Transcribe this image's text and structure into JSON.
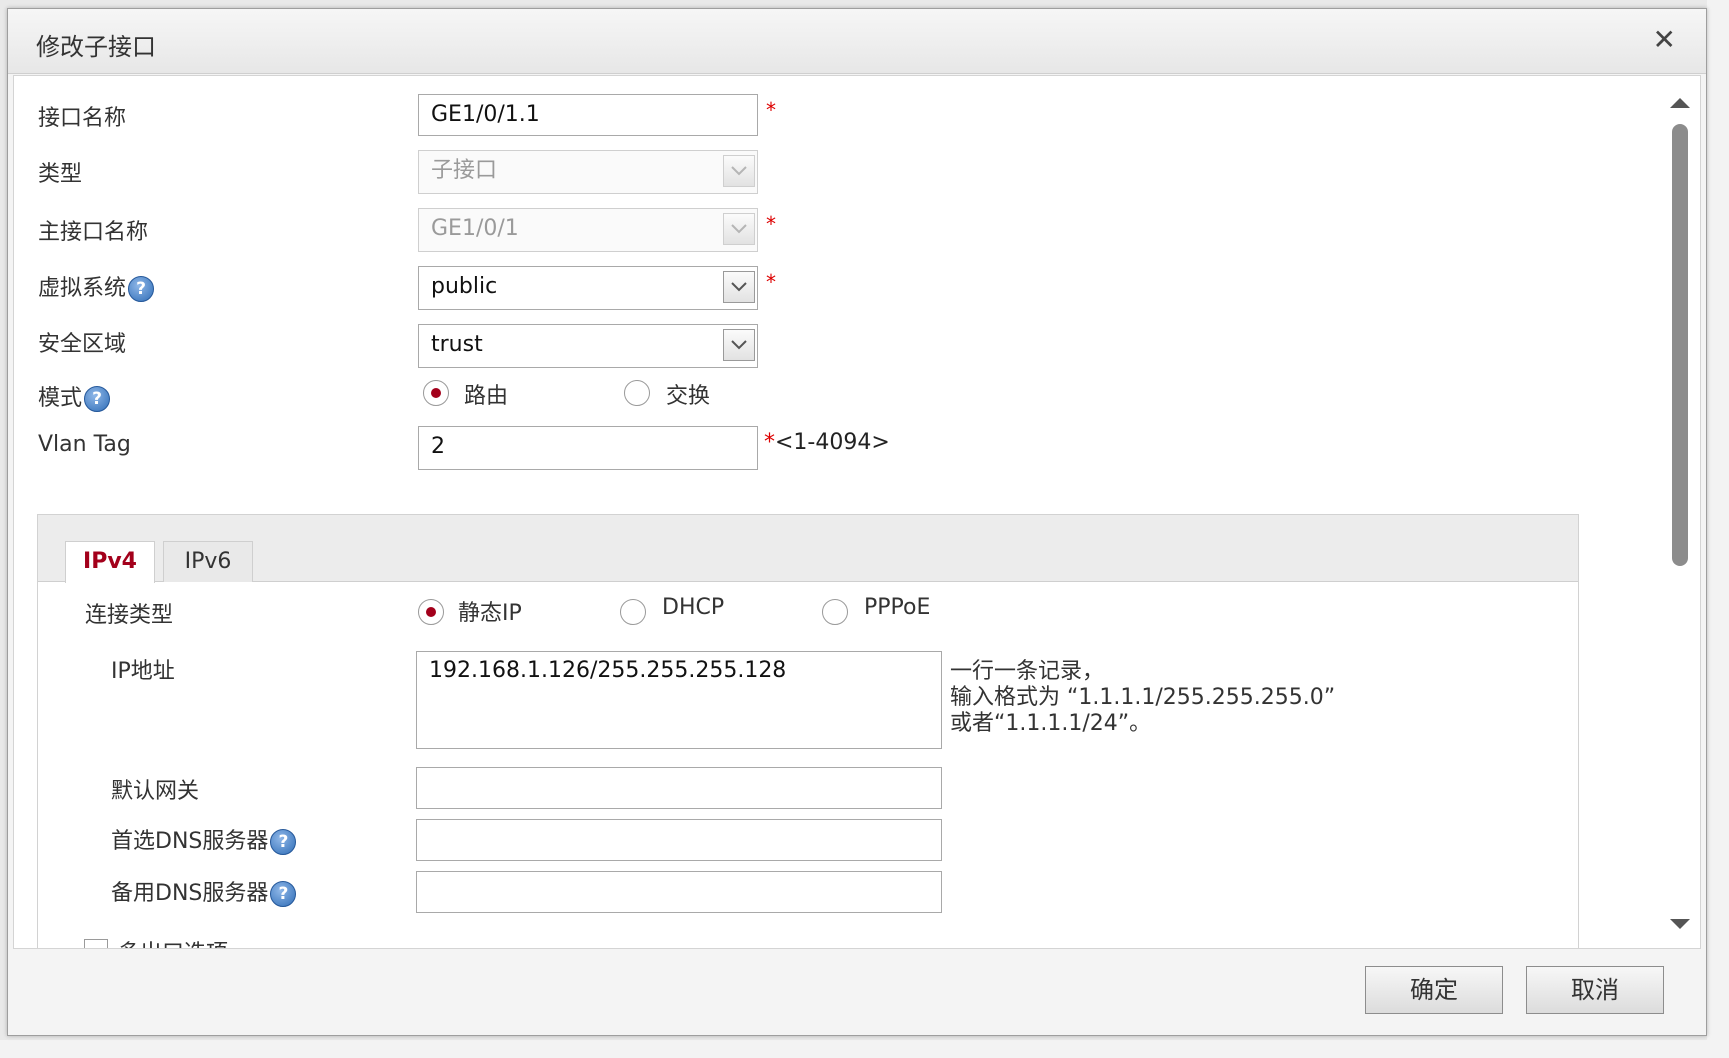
{
  "dialog": {
    "title": "修改子接口",
    "close_label": "✕"
  },
  "form": {
    "interface_name": {
      "label": "接口名称",
      "value": "GE1/0/1.1",
      "required": "*"
    },
    "type": {
      "label": "类型",
      "value": "子接口"
    },
    "parent_interface": {
      "label": "主接口名称",
      "value": "GE1/0/1",
      "required": "*"
    },
    "virtual_system": {
      "label": "虚拟系统",
      "value": "public",
      "required": "*"
    },
    "security_zone": {
      "label": "安全区域",
      "value": "trust"
    },
    "mode": {
      "label": "模式",
      "options": [
        "路由",
        "交换"
      ],
      "selected": "路由"
    },
    "vlan_tag": {
      "label": "Vlan Tag",
      "value": "2",
      "required": "*",
      "range": "<1-4094>"
    },
    "help_glyph": "?"
  },
  "tabs": [
    {
      "label": "IPv4",
      "active": true
    },
    {
      "label": "IPv6",
      "active": false
    }
  ],
  "ipv4": {
    "connection_type": {
      "label": "连接类型",
      "options": [
        "静态IP",
        "DHCP",
        "PPPoE"
      ],
      "selected": "静态IP"
    },
    "ip_address": {
      "label": "IP地址",
      "value": "192.168.1.126/255.255.255.128",
      "hint": [
        "一行一条记录，",
        "输入格式为 “1.1.1.1/255.255.255.0”",
        "或者“1.1.1.1/24”。"
      ]
    },
    "default_gateway": {
      "label": "默认网关",
      "value": ""
    },
    "primary_dns": {
      "label": "首选DNS服务器",
      "value": ""
    },
    "secondary_dns": {
      "label": "备用DNS服务器",
      "value": ""
    },
    "multi_egress": {
      "label": "多出口选项"
    }
  },
  "buttons": {
    "ok": "确定",
    "cancel": "取消"
  },
  "colors": {
    "accent": "#a3001b",
    "required": "#dd0000",
    "help": "#2f6db6"
  }
}
